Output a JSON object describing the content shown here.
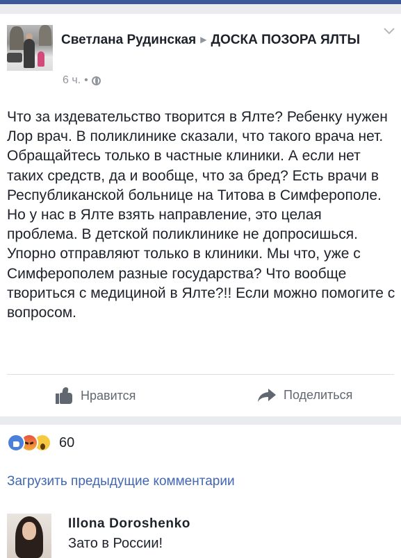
{
  "post": {
    "author": "Светлана Рудинская",
    "group": "ДОСКА ПОЗОРА ЯЛТЫ",
    "time": "6 ч.",
    "separator": "•",
    "text": "Что за издевательство творится в Ялте? Ребенку нужен Лор врач. В поликлинике сказали, что такого врача нет. Обращайтесь только в частные клиники. А если нет таких средств, да и вообще, что за бред? Есть врачи в Республиканской больнице на Титова в Симферополе. Но у нас в Ялте взять направление, это целая проблема. В детской поликлинике не допросишься. Упорно отправляют только в клиники. Мы что, уже с Симферополем разные государства? Что вообще твориться с медициной в Ялте?!! Если можно помогите с вопросом."
  },
  "actions": {
    "like_label": "Нравится",
    "share_label": "Поделиться"
  },
  "reactions": {
    "types": [
      "like",
      "angry",
      "wow"
    ],
    "count": "60"
  },
  "comments": {
    "load_previous": "Загрузить предыдущие комментарии",
    "items": [
      {
        "author": "Illona  Doroshenko",
        "text": "Зато в России!"
      }
    ]
  },
  "colors": {
    "brand": "#3b5998",
    "link": "#4267b2",
    "muted": "#90949c"
  }
}
